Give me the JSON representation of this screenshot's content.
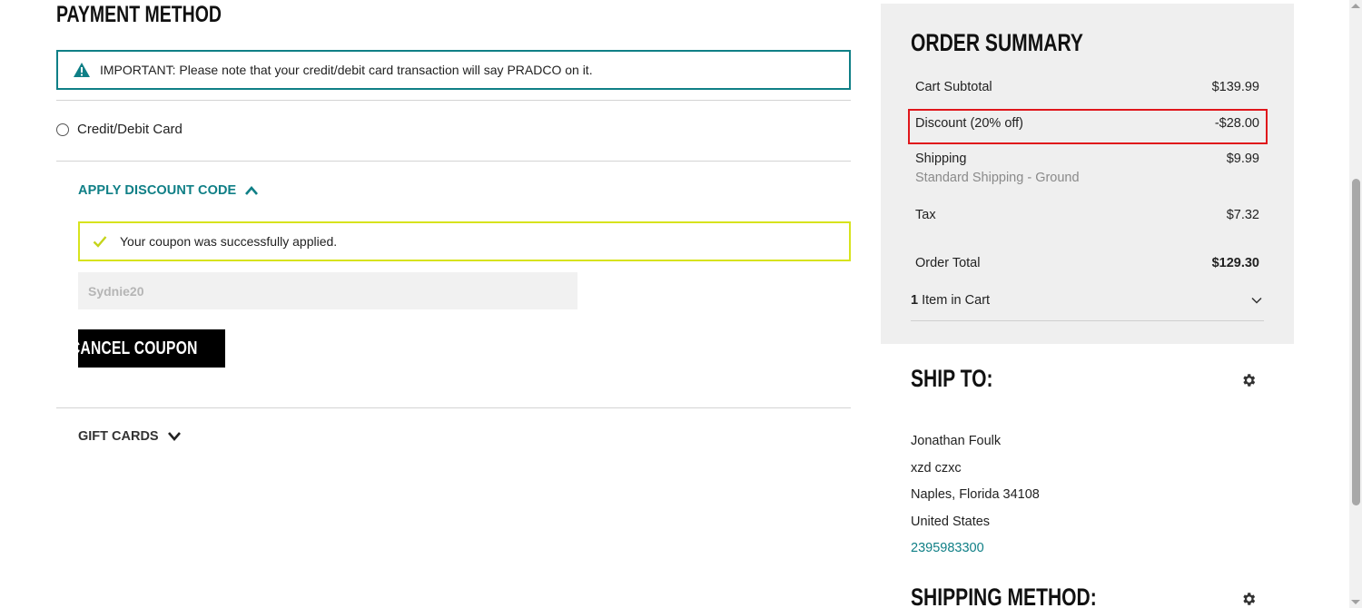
{
  "payment": {
    "title": "PAYMENT METHOD",
    "notice": "IMPORTANT: Please note that your credit/debit card transaction will say PRADCO on it.",
    "credit_option": "Credit/Debit Card",
    "apply_discount_label": "APPLY DISCOUNT CODE",
    "success_message": "Your coupon was successfully applied.",
    "coupon_value": "Sydnie20",
    "cancel_coupon_label": "CANCEL COUPON",
    "gift_cards_label": "GIFT CARDS"
  },
  "summary": {
    "title": "ORDER SUMMARY",
    "subtotal_label": "Cart Subtotal",
    "subtotal_value": "$139.99",
    "discount_label": "Discount (20% off)",
    "discount_value": "-$28.00",
    "shipping_label": "Shipping",
    "shipping_method": "Standard Shipping - Ground",
    "shipping_value": "$9.99",
    "tax_label": "Tax",
    "tax_value": "$7.32",
    "total_label": "Order Total",
    "total_value": "$129.30",
    "item_count": "1",
    "item_count_label": "Item in Cart"
  },
  "ship_to": {
    "title": "SHIP TO:",
    "name": "Jonathan Foulk",
    "street": "xzd czxc",
    "city_line": "Naples, Florida 34108",
    "country": "United States",
    "phone": "2395983300"
  },
  "shipping_method": {
    "title": "SHIPPING METHOD:"
  },
  "colors": {
    "teal": "#0f7f86",
    "success_border": "#d7e31d",
    "highlight": "#e0161b"
  }
}
